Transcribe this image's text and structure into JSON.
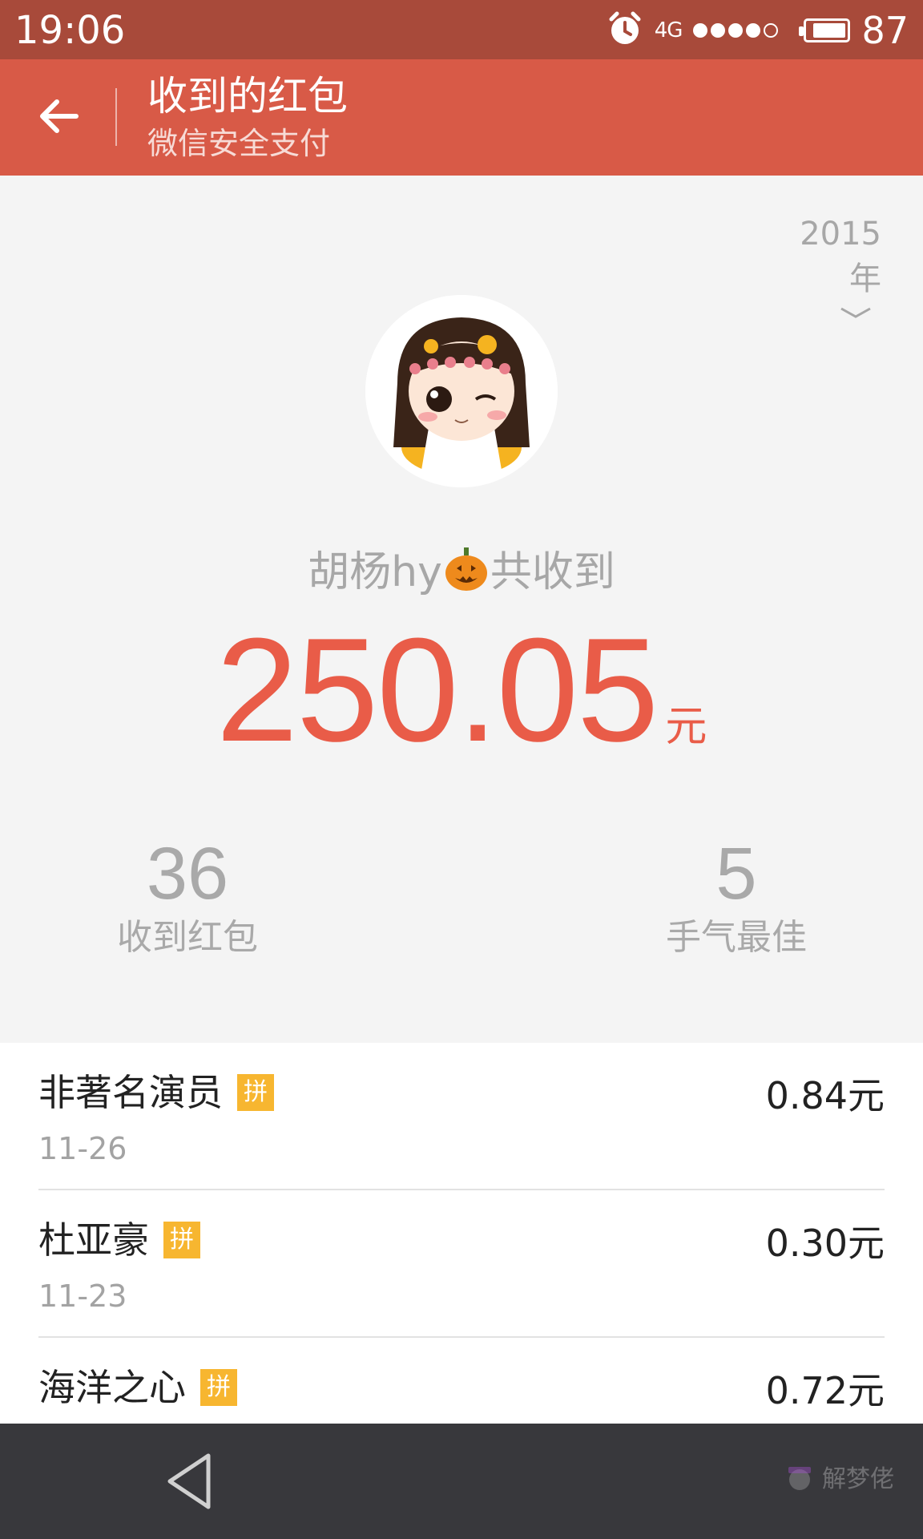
{
  "status_bar": {
    "time": "19:06",
    "network": "4G",
    "signal_bars": 4,
    "signal_max": 5,
    "battery_percent": "87",
    "battery_level": 0.87,
    "icons": [
      "alarm-icon",
      "battery-icon"
    ]
  },
  "header": {
    "back_icon": "arrow-left-icon",
    "title": "收到的红包",
    "subtitle": "微信安全支付"
  },
  "summary": {
    "year": "2015年",
    "year_icon": "chevron-down-icon",
    "user_name": "胡杨hy",
    "name_emoji": "jack-o-lantern-icon",
    "received_text": "共收到",
    "total_amount": "250.05",
    "total_unit": "元",
    "stats": [
      {
        "value": "36",
        "label": "收到红包"
      },
      {
        "value": "5",
        "label": "手气最佳"
      }
    ]
  },
  "list": {
    "badge": "拼",
    "items": [
      {
        "name": "非著名演员",
        "date": "11-26",
        "amount": "0.84元"
      },
      {
        "name": "杜亚豪",
        "date": "11-23",
        "amount": "0.30元"
      },
      {
        "name": "海洋之心",
        "date": "",
        "amount": "0.72元"
      }
    ]
  },
  "nav": {
    "back_icon": "triangle-back-icon",
    "watermark": "解梦佬"
  },
  "colors": {
    "status_bar": "#a84a3a",
    "header": "#d85a47",
    "accent_amount": "#e95c48",
    "badge": "#f7b630",
    "nav_bar": "#38383c"
  }
}
